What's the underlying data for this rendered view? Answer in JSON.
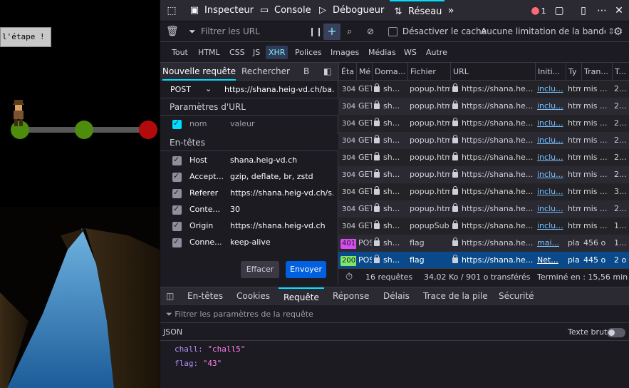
{
  "game": {
    "step_button": "l'étape !"
  },
  "devtools": {
    "tabs": [
      "Inspecteur",
      "Console",
      "Débogueur",
      "Réseau"
    ],
    "error_count": "1",
    "netbar": {
      "filter_placeholder": "Filtrer les URL",
      "disable_cache": "Désactiver le cache",
      "throttling": "Aucune limitation de la bande ..."
    },
    "type_filters": [
      "Tout",
      "HTML",
      "CSS",
      "JS",
      "XHR",
      "Polices",
      "Images",
      "Médias",
      "WS",
      "Autre"
    ],
    "composer": {
      "tabs": [
        "Nouvelle requête",
        "Rechercher",
        "B"
      ],
      "method": "POST",
      "url": "https://shana.heig-vd.ch/ba...",
      "url_params_title": "Paramètres d'URL",
      "param_name_placeholder": "nom",
      "param_value_placeholder": "valeur",
      "headers_title": "En-têtes",
      "headers": [
        {
          "name": "Host",
          "value": "shana.heig-vd.ch"
        },
        {
          "name": "Accept...",
          "value": "gzip, deflate, br, zstd"
        },
        {
          "name": "Referer",
          "value": "https://shana.heig-vd.ch/s..."
        },
        {
          "name": "Conte...",
          "value": "30"
        },
        {
          "name": "Origin",
          "value": "https://shana.heig-vd.ch"
        },
        {
          "name": "Conne...",
          "value": "keep-alive"
        }
      ],
      "clear_label": "Effacer",
      "send_label": "Envoyer"
    },
    "columns": [
      "Éta",
      "Mé",
      "Doma...",
      "Fichier",
      "URL",
      "Initi...",
      "Ty",
      "Tran...",
      "T..."
    ],
    "requests": [
      {
        "status": "304",
        "method": "GET",
        "domain": "sh...",
        "file": "popup.htm",
        "url": "https://shana.he...",
        "initiator": "inclu...",
        "type": "htm",
        "transferred": "mis ...",
        "size": "2..."
      },
      {
        "status": "304",
        "method": "GET",
        "domain": "sh...",
        "file": "popup.htm",
        "url": "https://shana.he...",
        "initiator": "inclu...",
        "type": "htm",
        "transferred": "mis ...",
        "size": "2..."
      },
      {
        "status": "304",
        "method": "GET",
        "domain": "sh...",
        "file": "popup.htm",
        "url": "https://shana.he...",
        "initiator": "inclu...",
        "type": "htm",
        "transferred": "mis ...",
        "size": "2..."
      },
      {
        "status": "304",
        "method": "GET",
        "domain": "sh...",
        "file": "popup.htm",
        "url": "https://shana.he...",
        "initiator": "inclu...",
        "type": "htm",
        "transferred": "mis ...",
        "size": "2..."
      },
      {
        "status": "304",
        "method": "GET",
        "domain": "sh...",
        "file": "popup.htm",
        "url": "https://shana.he...",
        "initiator": "inclu...",
        "type": "htm",
        "transferred": "mis ...",
        "size": "2..."
      },
      {
        "status": "304",
        "method": "GET",
        "domain": "sh...",
        "file": "popup.htm",
        "url": "https://shana.he...",
        "initiator": "inclu...",
        "type": "htm",
        "transferred": "mis ...",
        "size": "2..."
      },
      {
        "status": "304",
        "method": "GET",
        "domain": "sh...",
        "file": "popup.htm",
        "url": "https://shana.he...",
        "initiator": "inclu...",
        "type": "htm",
        "transferred": "mis ...",
        "size": "3..."
      },
      {
        "status": "304",
        "method": "GET",
        "domain": "sh...",
        "file": "popup.htm",
        "url": "https://shana.he...",
        "initiator": "inclu...",
        "type": "htm",
        "transferred": "mis ...",
        "size": "2..."
      },
      {
        "status": "304",
        "method": "GET",
        "domain": "sh...",
        "file": "popupSub",
        "url": "https://shana.he...",
        "initiator": "inclu...",
        "type": "htm",
        "transferred": "mis ...",
        "size": "1..."
      },
      {
        "status": "401",
        "method": "POST",
        "domain": "sh...",
        "file": "flag",
        "url": "https://shana.he...",
        "initiator": "mai...",
        "type": "pla",
        "transferred": "456 o",
        "size": "1..."
      },
      {
        "status": "200",
        "method": "POST",
        "domain": "sh...",
        "file": "flag",
        "url": "https://shana.he...",
        "initiator": "Net...",
        "type": "pla",
        "transferred": "445 o",
        "size": "2 o"
      }
    ],
    "status_bar": {
      "requests": "16 requêtes",
      "transferred": "34,02 Ko / 901 o transférés",
      "finished": "Terminé en : 15,56 min"
    },
    "detail_tabs": [
      "En-têtes",
      "Cookies",
      "Requête",
      "Réponse",
      "Délais",
      "Trace de la pile",
      "Sécurité"
    ],
    "detail_filter_placeholder": "Filtrer les paramètres de la requête",
    "json_label": "JSON",
    "raw_label": "Texte brut",
    "payload": [
      {
        "key": "chall:",
        "value": "\"chall5\""
      },
      {
        "key": "flag:",
        "value": "\"43\""
      }
    ],
    "colors": {
      "accent": "#00ddff",
      "status_401": "#d94cf0",
      "status_200": "#7ee66a",
      "selected_row": "#0a4a8a"
    }
  }
}
